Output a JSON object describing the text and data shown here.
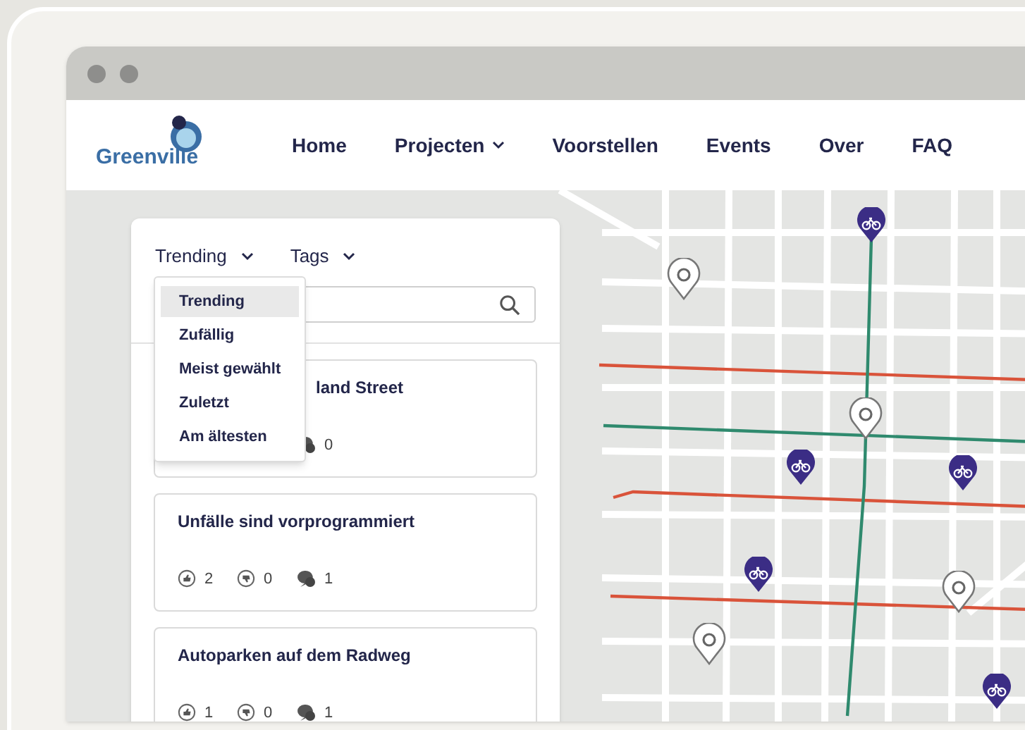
{
  "logo": {
    "text": "Greenville"
  },
  "nav": [
    {
      "label": "Home",
      "dropdown": false
    },
    {
      "label": "Projecten",
      "dropdown": true
    },
    {
      "label": "Voorstellen",
      "dropdown": false
    },
    {
      "label": "Events",
      "dropdown": false
    },
    {
      "label": "Over",
      "dropdown": false
    },
    {
      "label": "FAQ",
      "dropdown": false
    }
  ],
  "filters": [
    {
      "label": "Trending"
    },
    {
      "label": "Tags"
    }
  ],
  "sort_menu": [
    {
      "label": "Trending",
      "selected": true
    },
    {
      "label": "Zufällig",
      "selected": false
    },
    {
      "label": "Meist gewählt",
      "selected": false
    },
    {
      "label": "Zuletzt",
      "selected": false
    },
    {
      "label": "Am ältesten",
      "selected": false
    }
  ],
  "posts": [
    {
      "title": "land Street",
      "comments": "0"
    },
    {
      "title": "Unfälle sind vorprogrammiert",
      "likes": "2",
      "dislikes": "0",
      "comments": "1"
    },
    {
      "title": "Autoparken auf dem Radweg",
      "likes": "1",
      "dislikes": "0",
      "comments": "1"
    }
  ]
}
